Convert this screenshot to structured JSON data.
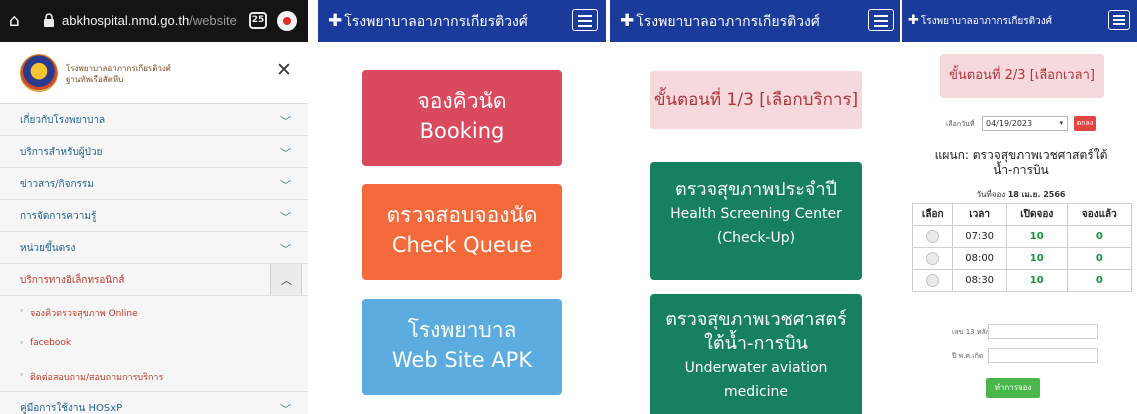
{
  "browser": {
    "url_domain": "abkhospital.nmd.go.th",
    "url_path": "/website",
    "tab_count": "25",
    "home_icon": "home-icon",
    "lock_icon": "lock-icon"
  },
  "sidebar": {
    "logo_text_line1": "โรงพยาบาลอาภากรเกียรติวงศ์",
    "logo_text_line2": "ฐานทัพเรือสัตหีบ",
    "close_icon": "close-icon",
    "items": [
      {
        "label": "เกี่ยวกับโรงพยาบาล",
        "icon": "chevron-down-icon"
      },
      {
        "label": "บริการสำหรับผู้ป่วย",
        "icon": "chevron-down-icon"
      },
      {
        "label": "ข่าวสาร/กิจกรรม",
        "icon": "chevron-down-icon"
      },
      {
        "label": "การจัดการความรู้",
        "icon": "chevron-down-icon"
      },
      {
        "label": "หน่วยขึ้นตรง",
        "icon": "chevron-down-icon"
      },
      {
        "label": "บริการทางอิเล็กทรอนิกส์",
        "icon": "chevron-up-icon",
        "active": true
      }
    ],
    "subitems": [
      {
        "label": "จองคิวตรวจสุขภาพ Online"
      },
      {
        "label": "facebook"
      },
      {
        "label": "ติดต่อสอบถาม/สอบถามการบริการ"
      }
    ],
    "last_item": {
      "label": "คู่มือการใช้งาน HOSxP",
      "icon": "chevron-down-icon"
    }
  },
  "app": {
    "brand_name": "โรงพยาบาลอาภากรเกียรติวงศ์",
    "brand_plus": "✚",
    "menu_icon": "hamburger-menu-icon"
  },
  "home": {
    "booking": {
      "th": "จองคิวนัด",
      "en": "Booking",
      "color": "#d94a5e"
    },
    "check_queue": {
      "th": "ตรวจสอบจองนัด",
      "en": "Check Queue",
      "color": "#f46a3a"
    },
    "website": {
      "th": "โรงพยาบาล",
      "en": "Web Site APK",
      "color": "#5cacdf"
    }
  },
  "step1": {
    "title": "ขั้นตอนที่ 1/3 [เลือกบริการ]",
    "services": [
      {
        "th": "ตรวจสุขภาพประจำปี",
        "en1": "Health Screening Center",
        "en2": "(Check-Up)"
      },
      {
        "th": "ตรวจสุขภาพเวชศาสตร์",
        "th2": "ใต้น้ำ-การบิน",
        "en1": "Underwater aviation",
        "en2": "medicine"
      }
    ]
  },
  "step2": {
    "title": "ขั้นตอนที่ 2/3 [เลือกเวลา]",
    "date_label": "เลือกวันที่",
    "date_value": "04/19/2023",
    "go_label": "ตกลง",
    "department_line1": "แผนก: ตรวจสุขภาพเวชศาสตร์ใต้",
    "department_line2": "น้ำ-การบิน",
    "booked_label": "วันที่จอง",
    "booked_date": "18 เม.ย. 2566",
    "columns": [
      "เลือก",
      "เวลา",
      "เปิดจอง",
      "จองแล้ว"
    ],
    "rows": [
      {
        "time": "07:30",
        "open": "10",
        "booked": "0"
      },
      {
        "time": "08:00",
        "open": "10",
        "booked": "0"
      },
      {
        "time": "08:30",
        "open": "10",
        "booked": "0"
      }
    ],
    "id_label": "เลข 13 หลัก",
    "birth_label": "ปี พ.ศ.เกิด",
    "submit_label": "ทำการจอง"
  }
}
